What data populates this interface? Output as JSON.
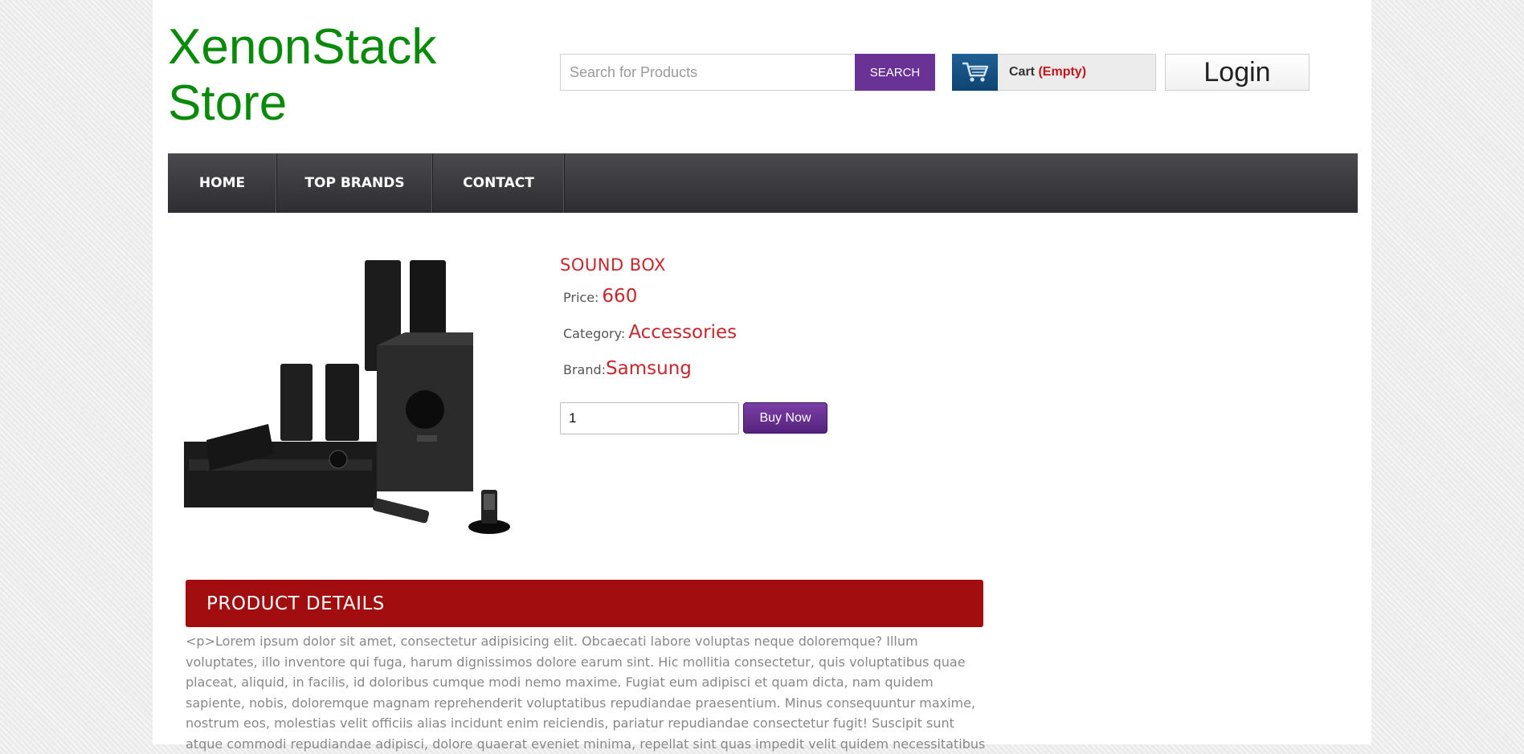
{
  "header": {
    "logo_line1": "XenonStack",
    "logo_line2": "Store",
    "search_placeholder": "Search for Products",
    "search_button": "SEARCH",
    "cart_label": "Cart",
    "cart_status": "(Empty)",
    "login_label": "Login"
  },
  "nav": {
    "items": [
      {
        "label": "HOME"
      },
      {
        "label": "TOP BRANDS"
      },
      {
        "label": "CONTACT"
      }
    ]
  },
  "product": {
    "title": "SOUND BOX",
    "price_label": "Price:",
    "price": "660",
    "category_label": "Category:",
    "category": "Accessories",
    "brand_label": "Brand:",
    "brand": "Samsung",
    "quantity": "1",
    "buy_button": "Buy Now",
    "image_icon": "speaker-system-image"
  },
  "details": {
    "heading": "PRODUCT DETAILS",
    "text": "<p>Lorem ipsum dolor sit amet, consectetur adipisicing elit. Obcaecati labore voluptas neque doloremque? Illum voluptates, illo inventore qui fuga, harum dignissimos dolore earum sint. Hic mollitia consectetur, quis voluptatibus quae placeat, aliquid, in facilis, id doloribus cumque modi nemo maxime. Fugiat eum adipisci et quam dicta, nam quidem sapiente, nobis, doloremque magnam reprehenderit voluptatibus repudiandae praesentium. Minus consequuntur maxime, nostrum eos, molestias velit officiis alias incidunt enim reiciendis, pariatur repudiandae consectetur fugit! Suscipit sunt atque commodi repudiandae adipisci, dolore quaerat eveniet minima, repellat sint quas impedit velit quidem necessitatibus"
  },
  "colors": {
    "logo": "#0a8a0a",
    "accent_purple": "#6b3296",
    "accent_red": "#c4282d",
    "nav_bg": "#3a3a3e",
    "details_header": "#a20d0f"
  }
}
